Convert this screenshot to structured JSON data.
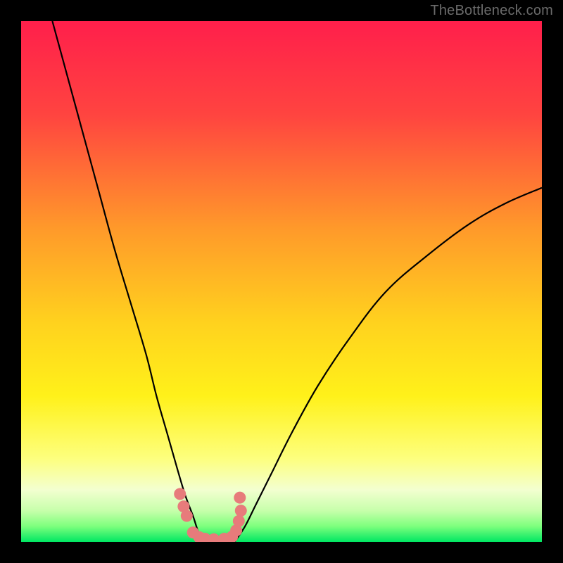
{
  "watermark": "TheBottleneck.com",
  "chart_data": {
    "type": "line",
    "title": "",
    "xlabel": "",
    "ylabel": "",
    "xlim": [
      0,
      100
    ],
    "ylim": [
      0,
      100
    ],
    "grid": false,
    "legend": false,
    "background_gradient_stops": [
      {
        "offset": 0.0,
        "color": "#ff1f4b"
      },
      {
        "offset": 0.18,
        "color": "#ff4440"
      },
      {
        "offset": 0.4,
        "color": "#ff9a2a"
      },
      {
        "offset": 0.58,
        "color": "#ffd21e"
      },
      {
        "offset": 0.72,
        "color": "#fff11a"
      },
      {
        "offset": 0.84,
        "color": "#fdff7e"
      },
      {
        "offset": 0.9,
        "color": "#f3ffd0"
      },
      {
        "offset": 0.94,
        "color": "#c7ffab"
      },
      {
        "offset": 0.97,
        "color": "#7dff7d"
      },
      {
        "offset": 1.0,
        "color": "#00e763"
      }
    ],
    "series": [
      {
        "name": "left-curve",
        "stroke": "#000000",
        "x": [
          6,
          9,
          12,
          15,
          18,
          21,
          24,
          26,
          28,
          30,
          31.5,
          33,
          34,
          35
        ],
        "y": [
          100,
          89,
          78,
          67,
          56,
          46,
          36,
          28,
          21,
          14,
          9,
          5,
          2,
          0
        ]
      },
      {
        "name": "right-curve",
        "stroke": "#000000",
        "x": [
          41,
          43,
          45,
          48,
          52,
          57,
          63,
          70,
          78,
          86,
          93,
          100
        ],
        "y": [
          0,
          3,
          7,
          13,
          21,
          30,
          39,
          48,
          55,
          61,
          65,
          68
        ]
      },
      {
        "name": "bottom-markers",
        "type": "scatter",
        "stroke": "#e77b7b",
        "fill": "#e77b7b",
        "x": [
          30.5,
          31.2,
          31.8,
          33.0,
          34.2,
          35.3,
          37.0,
          39.0,
          40.5,
          41.3,
          41.8,
          42.2,
          42.0
        ],
        "y": [
          9.2,
          6.8,
          5.0,
          1.8,
          0.9,
          0.6,
          0.5,
          0.6,
          1.0,
          2.2,
          4.0,
          6.0,
          8.5
        ]
      }
    ]
  }
}
